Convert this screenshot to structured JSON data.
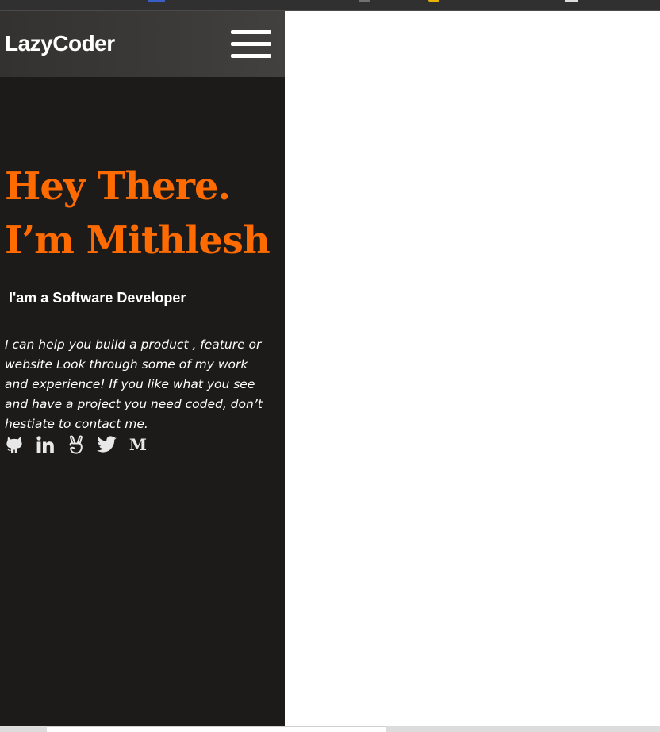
{
  "navbar": {
    "brand": "LazyCoder",
    "menu_icon": "hamburger-menu-icon"
  },
  "hero": {
    "title_line1": "Hey There.",
    "title_line2": "I’m Mithlesh",
    "subtitle": "I'am a Software Developer",
    "intro": "I can help you build a product , feature or website Look through some of my work and experience! If you like what you see and have a project you need coded, don’t hestiate to contact me."
  },
  "socials": [
    {
      "icon": "github-icon"
    },
    {
      "icon": "linkedin-icon"
    },
    {
      "icon": "angellist-icon"
    },
    {
      "icon": "twitter-icon"
    },
    {
      "icon": "medium-icon",
      "glyph": "M"
    }
  ],
  "colors": {
    "accent": "#ff6b00",
    "sidebar_bg": "#1c1b1a",
    "navbar_bg": "#3b3a38",
    "text": "#ffffff"
  }
}
